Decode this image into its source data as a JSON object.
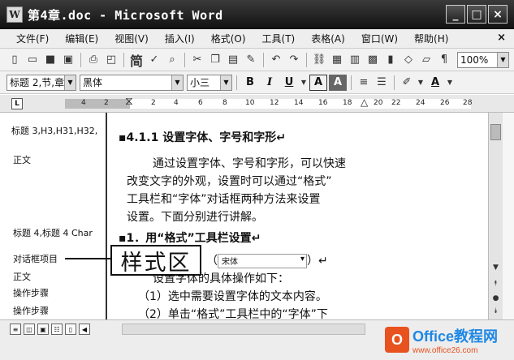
{
  "window": {
    "app_icon": "W",
    "title": "第4章.doc - Microsoft Word",
    "buttons": [
      "_",
      "□",
      "×"
    ]
  },
  "menu": {
    "items": [
      "文件(F)",
      "编辑(E)",
      "视图(V)",
      "插入(I)",
      "格式(O)",
      "工具(T)",
      "表格(A)",
      "窗口(W)",
      "帮助(H)"
    ],
    "close": "×"
  },
  "toolbar": {
    "zoom": "100%",
    "simplified": "简"
  },
  "format_toolbar": {
    "style": "标题 2,节,章",
    "font": "黑体",
    "size": "小三",
    "bold": "B",
    "italic": "I",
    "underline": "U",
    "font_color": "A"
  },
  "ruler": {
    "tab_marker": "L",
    "ticks": [
      "4",
      "2",
      "2",
      "4",
      "6",
      "8",
      "10",
      "12",
      "14",
      "16",
      "18",
      "20",
      "22",
      "24",
      "26",
      "28"
    ]
  },
  "style_area": {
    "entries": [
      "标题 3,H3,H31,H32,",
      "正文",
      "标题 4,标题 4 Char",
      "对话框项目",
      "正文",
      "操作步骤",
      "操作步骤"
    ]
  },
  "document": {
    "heading": "4.1.1   设置字体、字号和字形",
    "paragraph": [
      "通过设置字体、字号和字形，可以快速",
      "改变文字的外观，设置时可以通过“格式”",
      "工具栏和“字体”对话框两种方法来设置",
      "设置。下面分别进行讲解。"
    ],
    "subheading": "1．用“格式”工具栏设置",
    "combo_text": "宋体",
    "step_intro": "设置字体的具体操作如下：",
    "steps": [
      "（1）选中需要设置字体的文本内容。",
      "（2）单击“格式”工具栏中的“字体”下"
    ]
  },
  "callout": {
    "label": "样式区"
  },
  "watermark": {
    "logo_letter": "O",
    "line1": "Office教程网",
    "line2": "www.office26.com"
  }
}
